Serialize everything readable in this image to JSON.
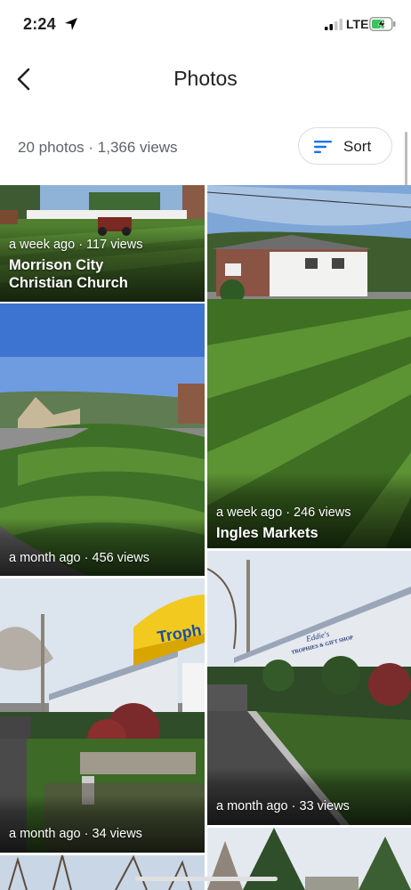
{
  "status_bar": {
    "time": "2:24",
    "network": "LTE"
  },
  "header": {
    "title": "Photos"
  },
  "summary": {
    "text": "20 photos · 1,366 views"
  },
  "sort": {
    "label": "Sort"
  },
  "photos": [
    {
      "meta": "a week ago · 117 views",
      "place": "Morrison City Christian Church"
    },
    {
      "meta": "a week ago · 246 views",
      "place": "Ingles Markets"
    },
    {
      "meta": "a month ago · 456 views",
      "place": ""
    },
    {
      "meta": "a month ago · 33 views",
      "place": ""
    },
    {
      "meta": "a month ago · 34 views",
      "place": ""
    }
  ],
  "signs": {
    "yellow_awning": "Troph",
    "shop_line1": "Eddie's",
    "shop_line2": "TROPHIES & GIFT SHOP"
  },
  "icons": [
    "location-arrow-icon",
    "signal-icon",
    "battery-charging-icon",
    "back-arrow-icon",
    "sort-icon"
  ]
}
